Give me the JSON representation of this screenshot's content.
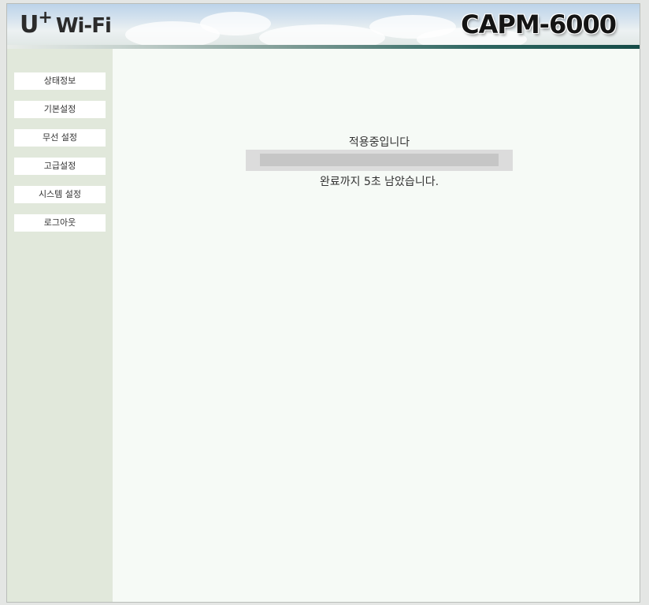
{
  "header": {
    "logo": {
      "u": "U",
      "plus": "+",
      "wifi": "Wi-Fi"
    },
    "model": "CAPM-6000"
  },
  "sidebar": {
    "items": [
      {
        "label": "상태정보"
      },
      {
        "label": "기본설정"
      },
      {
        "label": "무선 설정"
      },
      {
        "label": "고급설정"
      },
      {
        "label": "시스템 설정"
      },
      {
        "label": "로그아웃"
      }
    ]
  },
  "main": {
    "status_title": "적용중입니다",
    "countdown": "완료까지 5초 남았습니다."
  },
  "colors": {
    "sidebar_bg": "#e1e8db",
    "main_bg": "#f6faf6",
    "accent_teal": "#154c48"
  }
}
